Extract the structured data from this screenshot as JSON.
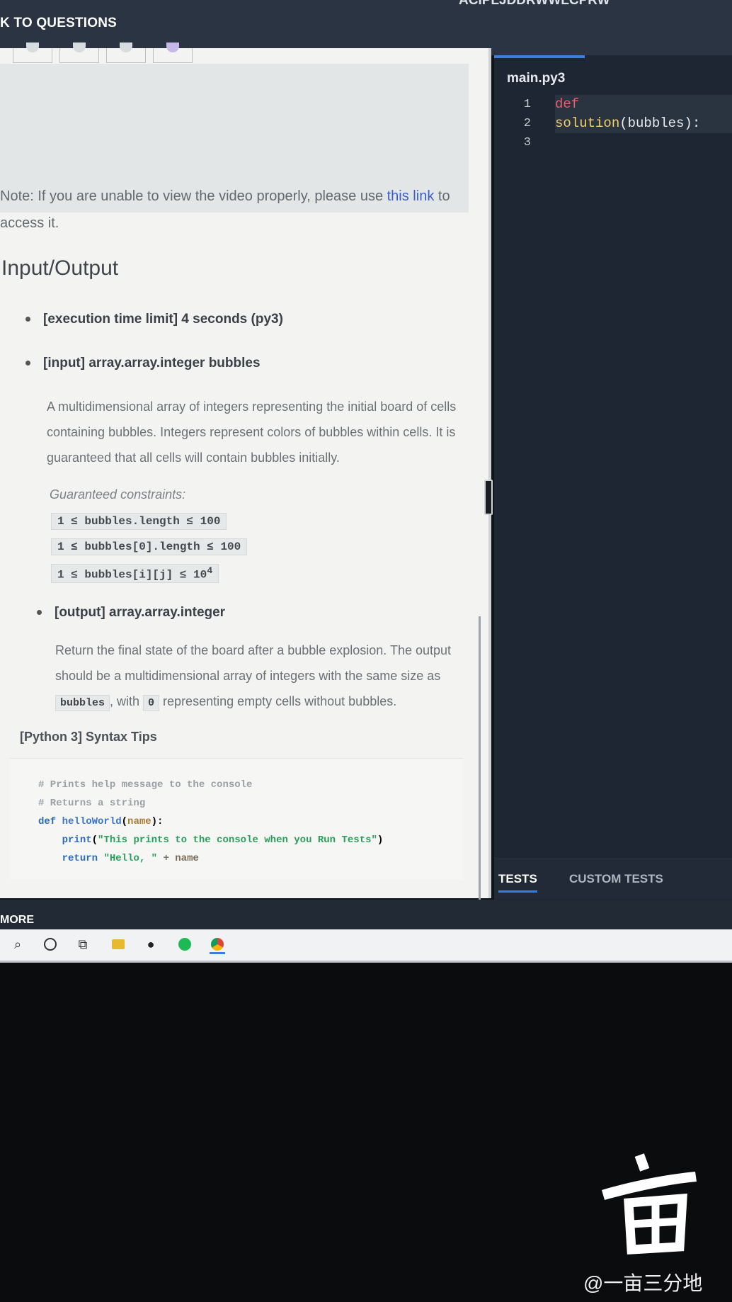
{
  "header": {
    "back_label": "K TO QUESTIONS",
    "task_code": "ACIPLJDDRWWLCPRW"
  },
  "description": {
    "note_prefix": "Note: If you are unable to view the video properly, please use ",
    "note_link": "this link",
    "note_suffix": " to access it.",
    "io_heading": "Input/Output",
    "bullets": [
      "[execution time limit] 4 seconds (py3)",
      "[input] array.array.integer bubbles",
      "[output] array.array.integer"
    ],
    "input_desc": "A multidimensional array of integers representing the initial board of cells containing bubbles. Integers represent colors of bubbles within cells. It is guaranteed that all cells will contain bubbles initially.",
    "constraints_title": "Guaranteed constraints:",
    "constraints": [
      "1 ≤ bubbles.length ≤ 100",
      "1 ≤ bubbles[0].length ≤ 100",
      "1 ≤ bubbles[i][j] ≤ 10"
    ],
    "constraint_exp": "4",
    "output_desc_1": "Return the final state of the board after a bubble explosion. The output should be a multidimensional array of integers with the same size as ",
    "output_code_1": "bubbles",
    "output_desc_2": ", with ",
    "output_code_2": "0",
    "output_desc_3": " representing empty cells without bubbles.",
    "tips_title": "[Python 3] Syntax Tips",
    "tips_code": {
      "l1": "# Prints help message to the console",
      "l2": "# Returns a string",
      "def_kw": "def",
      "fn_name": "helloWorld",
      "param": "name",
      "print_kw": "print",
      "print_arg": "\"This prints to the console when you Run Tests\"",
      "return_kw": "return",
      "return_str": "\"Hello, \"",
      "return_rest": "+ name"
    }
  },
  "editor": {
    "file_tab": "main.py3",
    "line_numbers": [
      "1",
      "2",
      "3"
    ],
    "code_kw": "def",
    "code_fn": "solution",
    "code_rest": "(bubbles):"
  },
  "tests": {
    "tab_tests": "TESTS",
    "tab_custom": "CUSTOM TESTS"
  },
  "bottom": {
    "more_label": "MORE"
  },
  "watermark": {
    "text": "@一亩三分地"
  },
  "colors": {
    "link": "#3a5fc8",
    "editor_bg": "#1d2632",
    "accent": "#3c7ee0"
  }
}
